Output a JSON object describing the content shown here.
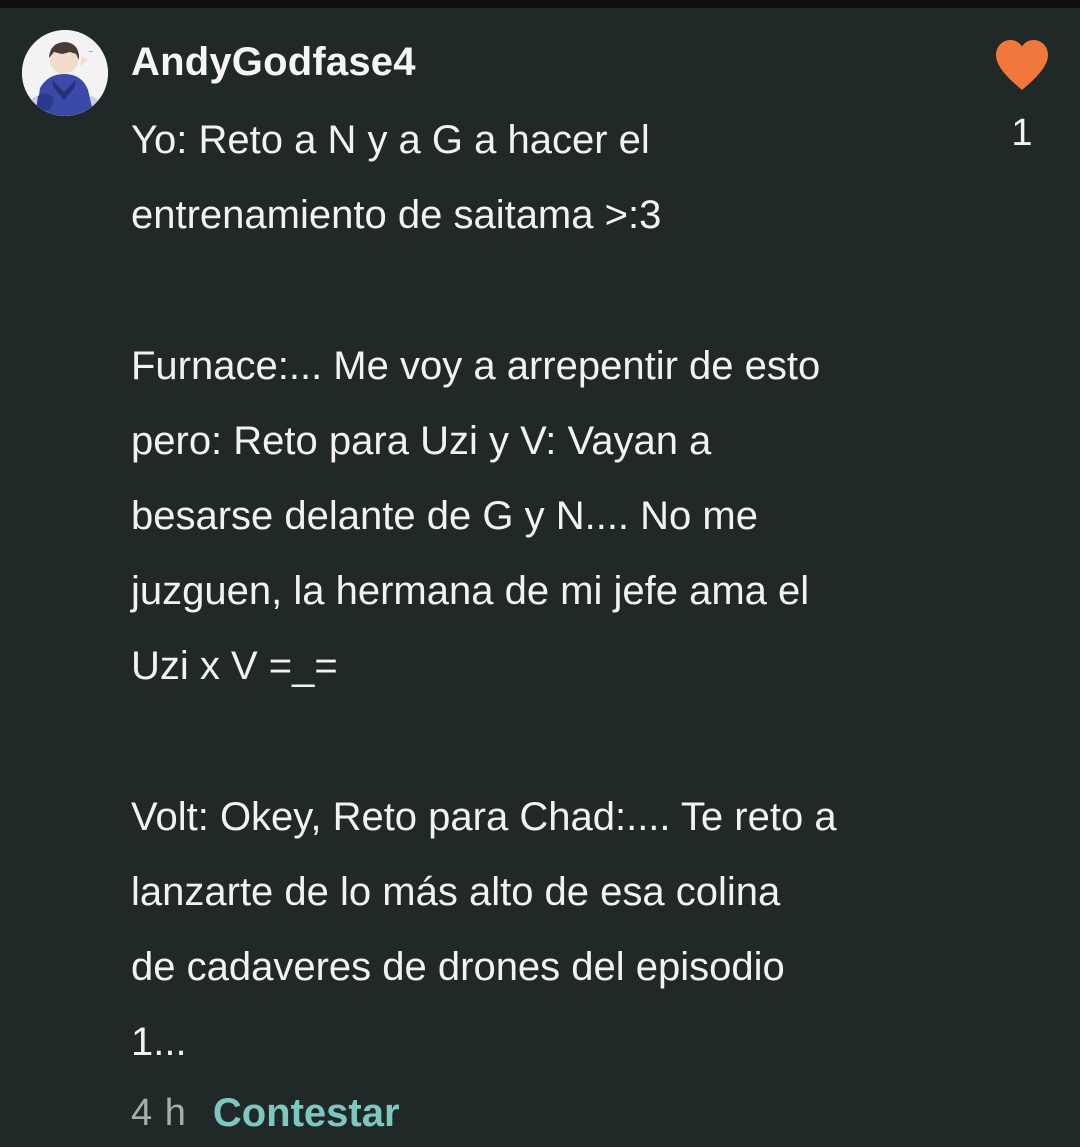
{
  "comment": {
    "author": "AndyGodfase4",
    "avatar_icon": "user-avatar-icon",
    "text": "Yo: Reto a N y a G a hacer el\nentrenamiento de saitama >:3\n\nFurnace:... Me voy a arrepentir de esto\npero: Reto para Uzi y V: Vayan a\nbesarse delante de G y N.... No me\njuzguen, la hermana de mi jefe ama el\nUzi x V =_=\n\nVolt: Okey, Reto para Chad:.... Te reto a\nlanzarte de lo más alto de esa colina\nde cadaveres de drones del episodio\n1...",
    "likes": "1",
    "like_icon": "heart-icon",
    "timestamp": "4 h",
    "reply_label": "Contestar"
  },
  "colors": {
    "background": "#212828",
    "heart": "#f2773c",
    "reply": "#7cc8c0",
    "timestamp": "#a8adad"
  }
}
